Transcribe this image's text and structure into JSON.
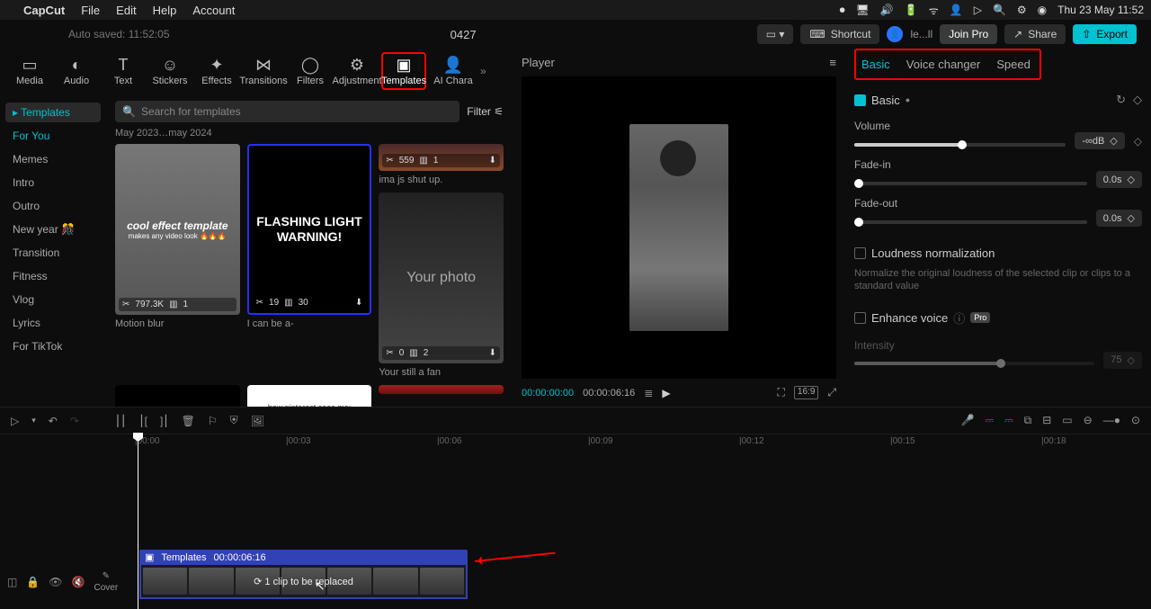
{
  "menubar": {
    "app": "CapCut",
    "items": [
      "File",
      "Edit",
      "Help",
      "Account"
    ],
    "clock": "Thu 23 May  11:52"
  },
  "topbar": {
    "autosaved": "Auto saved: 11:52:05",
    "title": "0427",
    "shortcut": "Shortcut",
    "user": "le...ll",
    "join_pro": "Join Pro",
    "share": "Share",
    "export": "Export"
  },
  "mode_tabs": [
    "Media",
    "Audio",
    "Text",
    "Stickers",
    "Effects",
    "Transitions",
    "Filters",
    "Adjustment",
    "Templates",
    "AI Chara"
  ],
  "mode_active": "Templates",
  "categories": {
    "top": "Templates",
    "items": [
      "For You",
      "Memes",
      "Intro",
      "Outro",
      "New year 🎊",
      "Transition",
      "Fitness",
      "Vlog",
      "Lyrics",
      "For TikTok"
    ],
    "active": "For You"
  },
  "search": {
    "placeholder": "Search for templates",
    "filter": "Filter"
  },
  "date_range": "May 2023…may 2024",
  "templates": {
    "card1": {
      "line1": "cool effect template",
      "line2": "makes any video look 🔥🔥🔥",
      "uses": "797.3K",
      "clips": "1",
      "caption": "Motion blur"
    },
    "card2": {
      "warn": "FLASHING LIGHT WARNING!",
      "uses": "19",
      "clips": "30",
      "caption": "I can be a-"
    },
    "card3": {
      "uses": "559",
      "clips": "1",
      "caption": "ima js shut up."
    },
    "card4": {
      "text": "Your photo",
      "uses": "0",
      "clips": "2",
      "caption": "Your still a fan"
    },
    "card5": {
      "text": "how pinterest sees me:"
    }
  },
  "player": {
    "label": "Player",
    "current": "00:00:00:00",
    "duration": "00:00:06:16",
    "ratio": "16:9"
  },
  "inspector": {
    "tabs": [
      "Basic",
      "Voice changer",
      "Speed"
    ],
    "active": "Basic",
    "section": "Basic",
    "volume_label": "Volume",
    "volume_value": "-∞dB",
    "fadein_label": "Fade-in",
    "fadein_value": "0.0s",
    "fadeout_label": "Fade-out",
    "fadeout_value": "0.0s",
    "loudness_label": "Loudness normalization",
    "loudness_desc": "Normalize the original loudness of the selected clip or clips to a standard value",
    "enhance_label": "Enhance voice",
    "pro": "Pro",
    "intensity_label": "Intensity",
    "intensity_value": "75"
  },
  "ruler": [
    "|00:00",
    "|00:03",
    "|00:06",
    "|00:09",
    "|00:12",
    "|00:15",
    "|00:18"
  ],
  "clip": {
    "type": "Templates",
    "duration": "00:00:06:16",
    "overlay": "1 clip to be replaced"
  },
  "cover": "Cover"
}
